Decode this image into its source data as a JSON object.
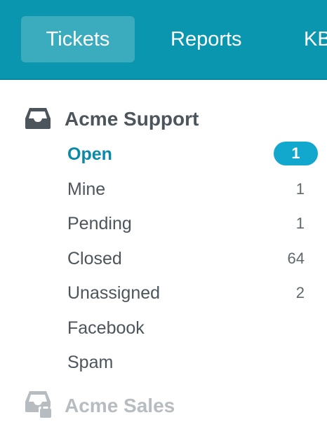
{
  "nav": {
    "tabs": [
      {
        "label": "Tickets",
        "active": true
      },
      {
        "label": "Reports"
      },
      {
        "label": "KB"
      }
    ],
    "bg_color": "#0a96ae"
  },
  "mailboxes": [
    {
      "name": "Acme Support",
      "icon": "inbox-icon",
      "folders": [
        {
          "label": "Open",
          "count": "1",
          "active": true
        },
        {
          "label": "Mine",
          "count": "1"
        },
        {
          "label": "Pending",
          "count": "1"
        },
        {
          "label": "Closed",
          "count": "64"
        },
        {
          "label": "Unassigned",
          "count": "2"
        },
        {
          "label": "Facebook",
          "count": ""
        },
        {
          "label": "Spam",
          "count": ""
        }
      ]
    },
    {
      "name": "Acme Sales",
      "icon": "locked-inbox-icon",
      "locked": true
    }
  ],
  "colors": {
    "accent": "#0a8aa6",
    "badge": "#12a7cc",
    "text": "#4d555c",
    "muted": "#b7bcc0"
  }
}
